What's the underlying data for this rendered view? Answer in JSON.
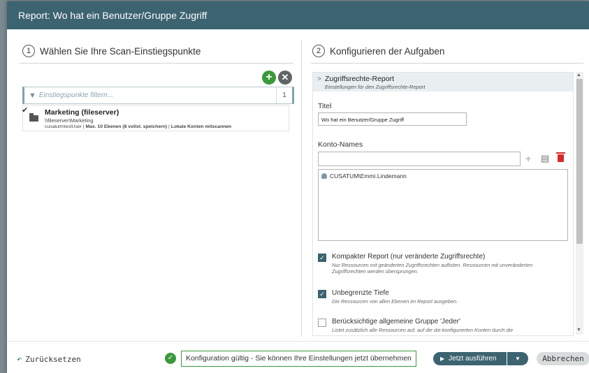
{
  "dialog": {
    "title": "Report: Wo hat ein Benutzer/Gruppe Zugriff"
  },
  "left": {
    "step_number": "1",
    "heading": "Wählen Sie Ihre Scan-Einstiegspunkte",
    "filter_placeholder": "Einstiegspunkte filtern...",
    "filter_count": "1",
    "entries": [
      {
        "title": "Marketing (fileserver)",
        "path": "\\\\fileserver\\Marketing",
        "user": "cusatum\\testUser",
        "depth": "Max. 10 Ebenen (8 vollst. speichern)",
        "option": "Lokale Konten mitscannen"
      }
    ]
  },
  "right": {
    "step_number": "2",
    "heading": "Konfigurieren der Aufgaben",
    "section_title": "Zugriffsrechte-Report",
    "section_subtitle": "Einstellungen für den Zugriffsrechte-Report",
    "titel_label": "Titel",
    "titel_value": "Wo hat ein Benutzer/Gruppe Zugriff",
    "konto_label": "Konto-Names",
    "konto_input_value": "",
    "accounts": [
      "CUSATUM\\Emmi.Lindemann"
    ],
    "options": [
      {
        "checked": true,
        "title": "Kompakter Report (nur veränderte Zugriffsrechte)",
        "desc": "Nur Ressourcen mit geänderten Zugriffsrechten auflisten. Ressourcen mit unveränderten Zugriffsrechten werden übersprungen."
      },
      {
        "checked": true,
        "title": "Unbegrenzte Tiefe",
        "desc": "Die Ressourcen von allen Ebenen im Report ausgeben."
      },
      {
        "checked": false,
        "title": "Berücksichtige allgemeine Gruppe 'Jeder'",
        "desc": "Listet zusätzlich alle Ressourcen auf, auf die die konfigurierten Konten durch die"
      }
    ]
  },
  "footer": {
    "reset_label": "Zurücksetzen",
    "status_text": "Konfiguration gültig - Sie können Ihre Einstellungen jetzt übernehmen",
    "run_label": "Jetzt ausführen",
    "cancel_label": "Abbrechen"
  },
  "colors": {
    "accent": "#3c6370",
    "ok": "#3a9a3a",
    "danger": "#d62a2a"
  },
  "icons": [
    "filter-icon",
    "folder-icon",
    "check-icon",
    "add-icon",
    "remove-icon",
    "plus-icon",
    "clipboard-icon",
    "trash-icon",
    "user-group-icon",
    "reset-icon",
    "ok-icon",
    "play-icon",
    "chevron-down-icon",
    "chevron-right-icon"
  ]
}
